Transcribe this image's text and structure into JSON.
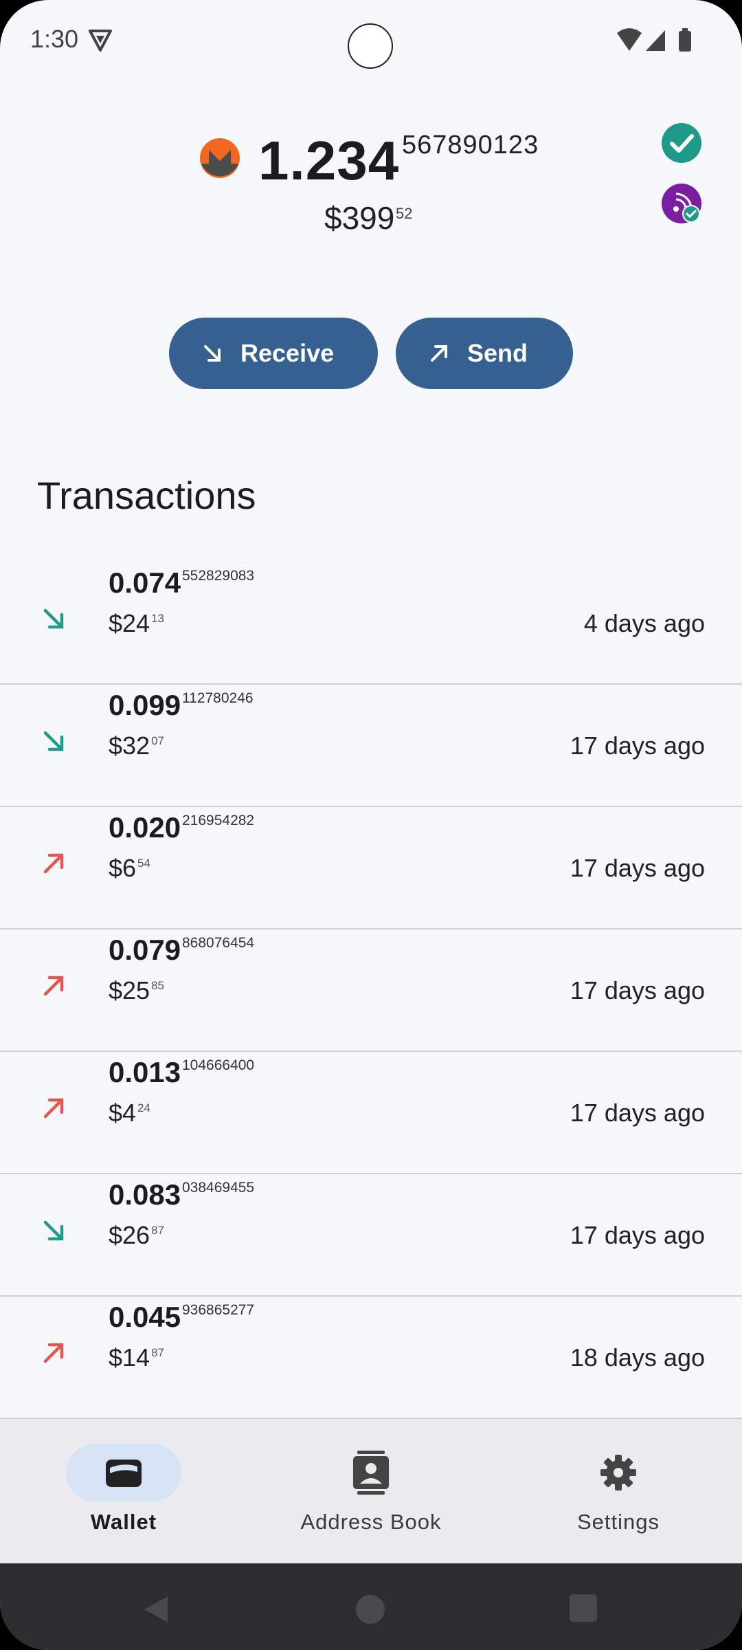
{
  "status_bar": {
    "time": "1:30"
  },
  "balance": {
    "coin_icon": "monero-logo",
    "main": "1.234",
    "fraction": "567890123",
    "fiat_main": "$399",
    "fiat_fraction": "52",
    "sync_icon": "check-circle-icon",
    "tor_icon": "tor-connected-icon"
  },
  "actions": {
    "receive_label": "Receive",
    "send_label": "Send"
  },
  "transactions_title": "Transactions",
  "transactions": [
    {
      "direction": "incoming",
      "amount": "0.074",
      "amount_fraction": "552829083",
      "fiat": "$24",
      "fiat_fraction": "13",
      "time": "4 days ago"
    },
    {
      "direction": "incoming",
      "amount": "0.099",
      "amount_fraction": "112780246",
      "fiat": "$32",
      "fiat_fraction": "07",
      "time": "17 days ago"
    },
    {
      "direction": "outgoing",
      "amount": "0.020",
      "amount_fraction": "216954282",
      "fiat": "$6",
      "fiat_fraction": "54",
      "time": "17 days ago"
    },
    {
      "direction": "outgoing",
      "amount": "0.079",
      "amount_fraction": "868076454",
      "fiat": "$25",
      "fiat_fraction": "85",
      "time": "17 days ago"
    },
    {
      "direction": "outgoing",
      "amount": "0.013",
      "amount_fraction": "104666400",
      "fiat": "$4",
      "fiat_fraction": "24",
      "time": "17 days ago"
    },
    {
      "direction": "incoming",
      "amount": "0.083",
      "amount_fraction": "038469455",
      "fiat": "$26",
      "fiat_fraction": "87",
      "time": "17 days ago"
    },
    {
      "direction": "outgoing",
      "amount": "0.045",
      "amount_fraction": "936865277",
      "fiat": "$14",
      "fiat_fraction": "87",
      "time": "18 days ago"
    }
  ],
  "nav": {
    "wallet": "Wallet",
    "address_book": "Address Book",
    "settings": "Settings"
  },
  "colors": {
    "accent": "#36608f",
    "incoming": "#1f9a8a",
    "outgoing": "#e0574f",
    "monero_orange": "#f26822"
  }
}
